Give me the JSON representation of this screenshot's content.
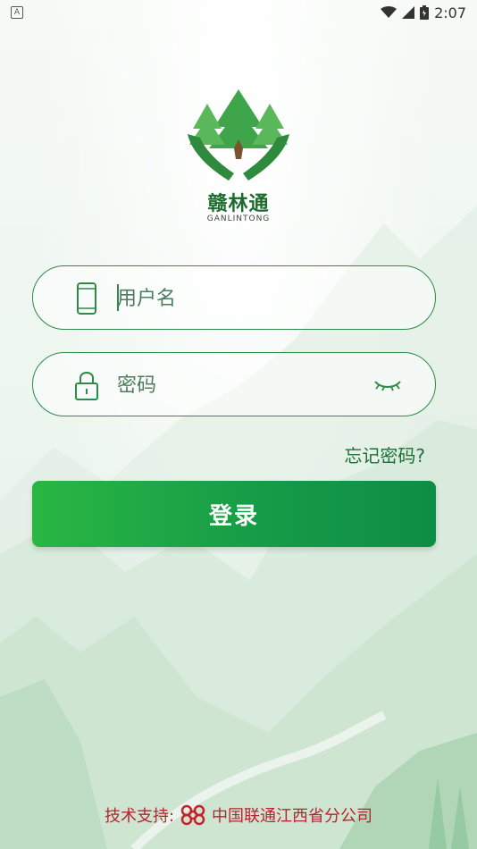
{
  "status_bar": {
    "time": "2:07",
    "notification": "A"
  },
  "logo": {
    "title": "赣林通",
    "subtitle": "GANLINTONG"
  },
  "login_form": {
    "username_placeholder": "用户名",
    "password_placeholder": "密码",
    "forgot_password": "忘记密码?",
    "login_button": "登录"
  },
  "footer": {
    "label": "技术支持:",
    "company": "中国联通江西省分公司"
  },
  "colors": {
    "primary": "#1d8a43",
    "button_start": "#2ab643",
    "button_end": "#0e8e45",
    "footer_text": "#b8232e"
  }
}
